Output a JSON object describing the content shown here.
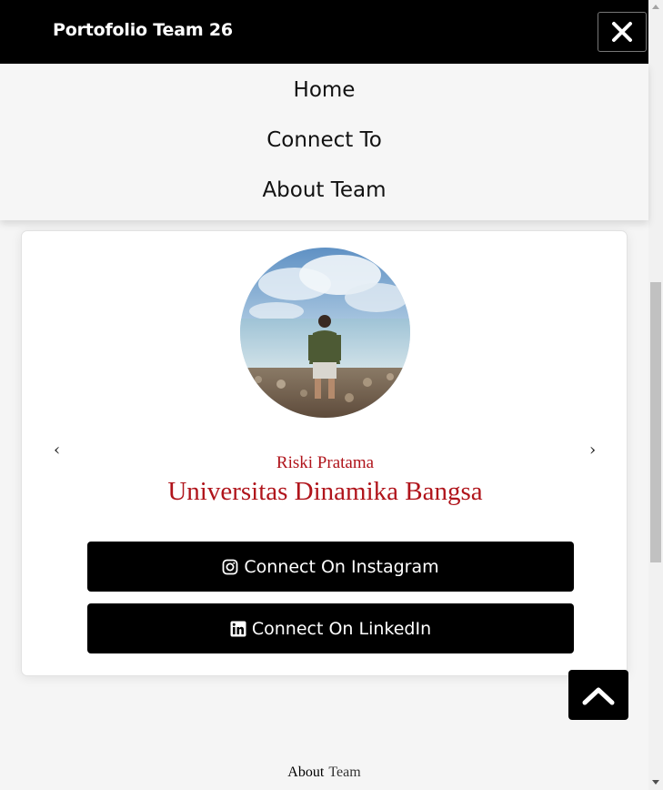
{
  "header": {
    "brand": "Portofolio Team 26",
    "close_icon": "close-icon"
  },
  "menu": {
    "items": [
      {
        "label": "Home"
      },
      {
        "label": "Connect To"
      },
      {
        "label": "About Team"
      }
    ]
  },
  "profile": {
    "prev_arrow": "‹",
    "next_arrow": "›",
    "name": "Riski Pratama",
    "university": "Universitas Dinamika Bangsa",
    "instagram_label": "Connect On Instagram",
    "linkedin_label": "Connect On LinkedIn"
  },
  "footer": {
    "about_word": "About",
    "team_word": "Team"
  },
  "colors": {
    "header_bg": "#000000",
    "accent_red": "#b0141b",
    "button_bg": "#000000"
  }
}
